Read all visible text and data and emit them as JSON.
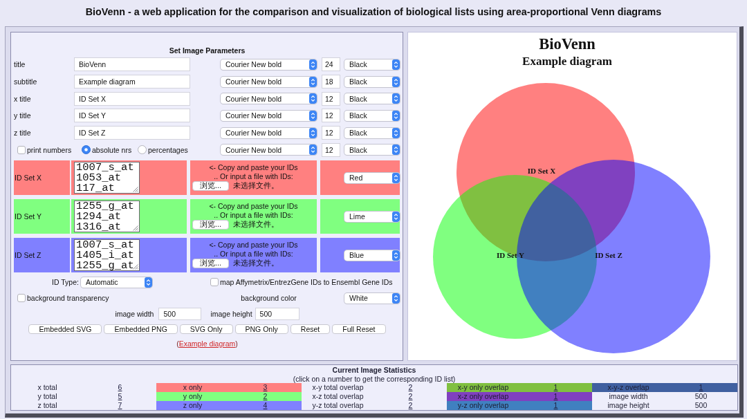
{
  "header": {
    "title": "BioVenn - a web application for the comparison and visualization of biological lists using area-proportional Venn diagrams"
  },
  "parameters": {
    "heading": "Set Image Parameters",
    "titles": [
      {
        "label": "title",
        "value": "BioVenn",
        "font": "Courier New bold",
        "size": "24",
        "color_name": "Black"
      },
      {
        "label": "subtitle",
        "value": "Example diagram",
        "font": "Courier New bold",
        "size": "18",
        "color_name": "Black"
      },
      {
        "label": "x title",
        "value": "ID Set X",
        "font": "Courier New bold",
        "size": "12",
        "color_name": "Black"
      },
      {
        "label": "y title",
        "value": "ID Set Y",
        "font": "Courier New bold",
        "size": "12",
        "color_name": "Black"
      },
      {
        "label": "z title",
        "value": "ID Set Z",
        "font": "Courier New bold",
        "size": "12",
        "color_name": "Black"
      }
    ],
    "numbers": {
      "print_numbers": {
        "label": "print numbers",
        "checked": false
      },
      "modes": [
        {
          "label": "absolute nrs",
          "selected": true
        },
        {
          "label": "percentages",
          "selected": false
        }
      ],
      "font": "Courier New bold",
      "size": "12",
      "color_name": "Black"
    },
    "sets": [
      {
        "label": "ID Set X",
        "ids": [
          "1007_s_at",
          "1053_at",
          "117_at"
        ],
        "paste_hint": "<- Copy and paste your IDs",
        "file_hint": ".. Or input a file with IDs:",
        "browse": "浏览...",
        "file_status": "未选择文件。",
        "color_name": "Red",
        "color": "#ff8080"
      },
      {
        "label": "ID Set Y",
        "ids": [
          "1255_g_at",
          "1294_at",
          "1316_at"
        ],
        "paste_hint": "<- Copy and paste your IDs",
        "file_hint": ".. Or input a file with IDs:",
        "browse": "浏览...",
        "file_status": "未选择文件。",
        "color_name": "Lime",
        "color": "#80ff80"
      },
      {
        "label": "ID Set Z",
        "ids": [
          "1007_s_at",
          "1405_i_at",
          "1255_g_at"
        ],
        "paste_hint": "<- Copy and paste your IDs",
        "file_hint": ".. Or input a file with IDs:",
        "browse": "浏览...",
        "file_status": "未选择文件。",
        "color_name": "Blue",
        "color": "#8080ff"
      }
    ],
    "id_type": {
      "label": "ID Type:",
      "value": "Automatic"
    },
    "map_ids": {
      "label": "map Affymetrix/EntrezGene IDs to Ensembl Gene IDs",
      "checked": false
    },
    "background_transparency": {
      "label": "background transparency",
      "checked": false
    },
    "background_color": {
      "label": "background color",
      "value": "White"
    },
    "image_width": {
      "label": "image width",
      "value": "500"
    },
    "image_height": {
      "label": "image height",
      "value": "500"
    },
    "buttons": [
      "Embedded SVG",
      "Embedded PNG",
      "SVG Only",
      "PNG Only",
      "Reset",
      "Full Reset"
    ],
    "example": {
      "open": "(",
      "link": "Example diagram",
      "close": ")"
    }
  },
  "diagram": {
    "title": "BioVenn",
    "subtitle": "Example diagram",
    "set_labels": [
      "ID Set X",
      "ID Set Y",
      "ID Set Z"
    ]
  },
  "statistics": {
    "title": "Current Image Statistics",
    "hint": "(click on a number to get the corresponding ID list)",
    "rows": [
      [
        {
          "label": "x total",
          "value": "6",
          "link": true
        },
        {
          "label": "x only",
          "value": "3",
          "link": true,
          "color": "#ff8080"
        },
        {
          "label": "x-y total overlap",
          "value": "2",
          "link": true
        },
        {
          "label": "x-y only overlap",
          "value": "1",
          "link": true,
          "color": "#80c040"
        },
        {
          "label": "x-y-z overlap",
          "value": "1",
          "link": true,
          "color": "#4060a0"
        }
      ],
      [
        {
          "label": "y total",
          "value": "5",
          "link": true
        },
        {
          "label": "y only",
          "value": "2",
          "link": true,
          "color": "#80ff80"
        },
        {
          "label": "x-z total overlap",
          "value": "2",
          "link": true
        },
        {
          "label": "x-z only overlap",
          "value": "1",
          "link": true,
          "color": "#8040c0"
        },
        {
          "label": "image width",
          "value": "500",
          "link": false
        }
      ],
      [
        {
          "label": "z total",
          "value": "7",
          "link": true
        },
        {
          "label": "z only",
          "value": "4",
          "link": true,
          "color": "#8080ff"
        },
        {
          "label": "y-z total overlap",
          "value": "2",
          "link": true
        },
        {
          "label": "y-z only overlap",
          "value": "1",
          "link": true,
          "color": "#4080c0"
        },
        {
          "label": "image height",
          "value": "500",
          "link": false
        }
      ]
    ]
  }
}
